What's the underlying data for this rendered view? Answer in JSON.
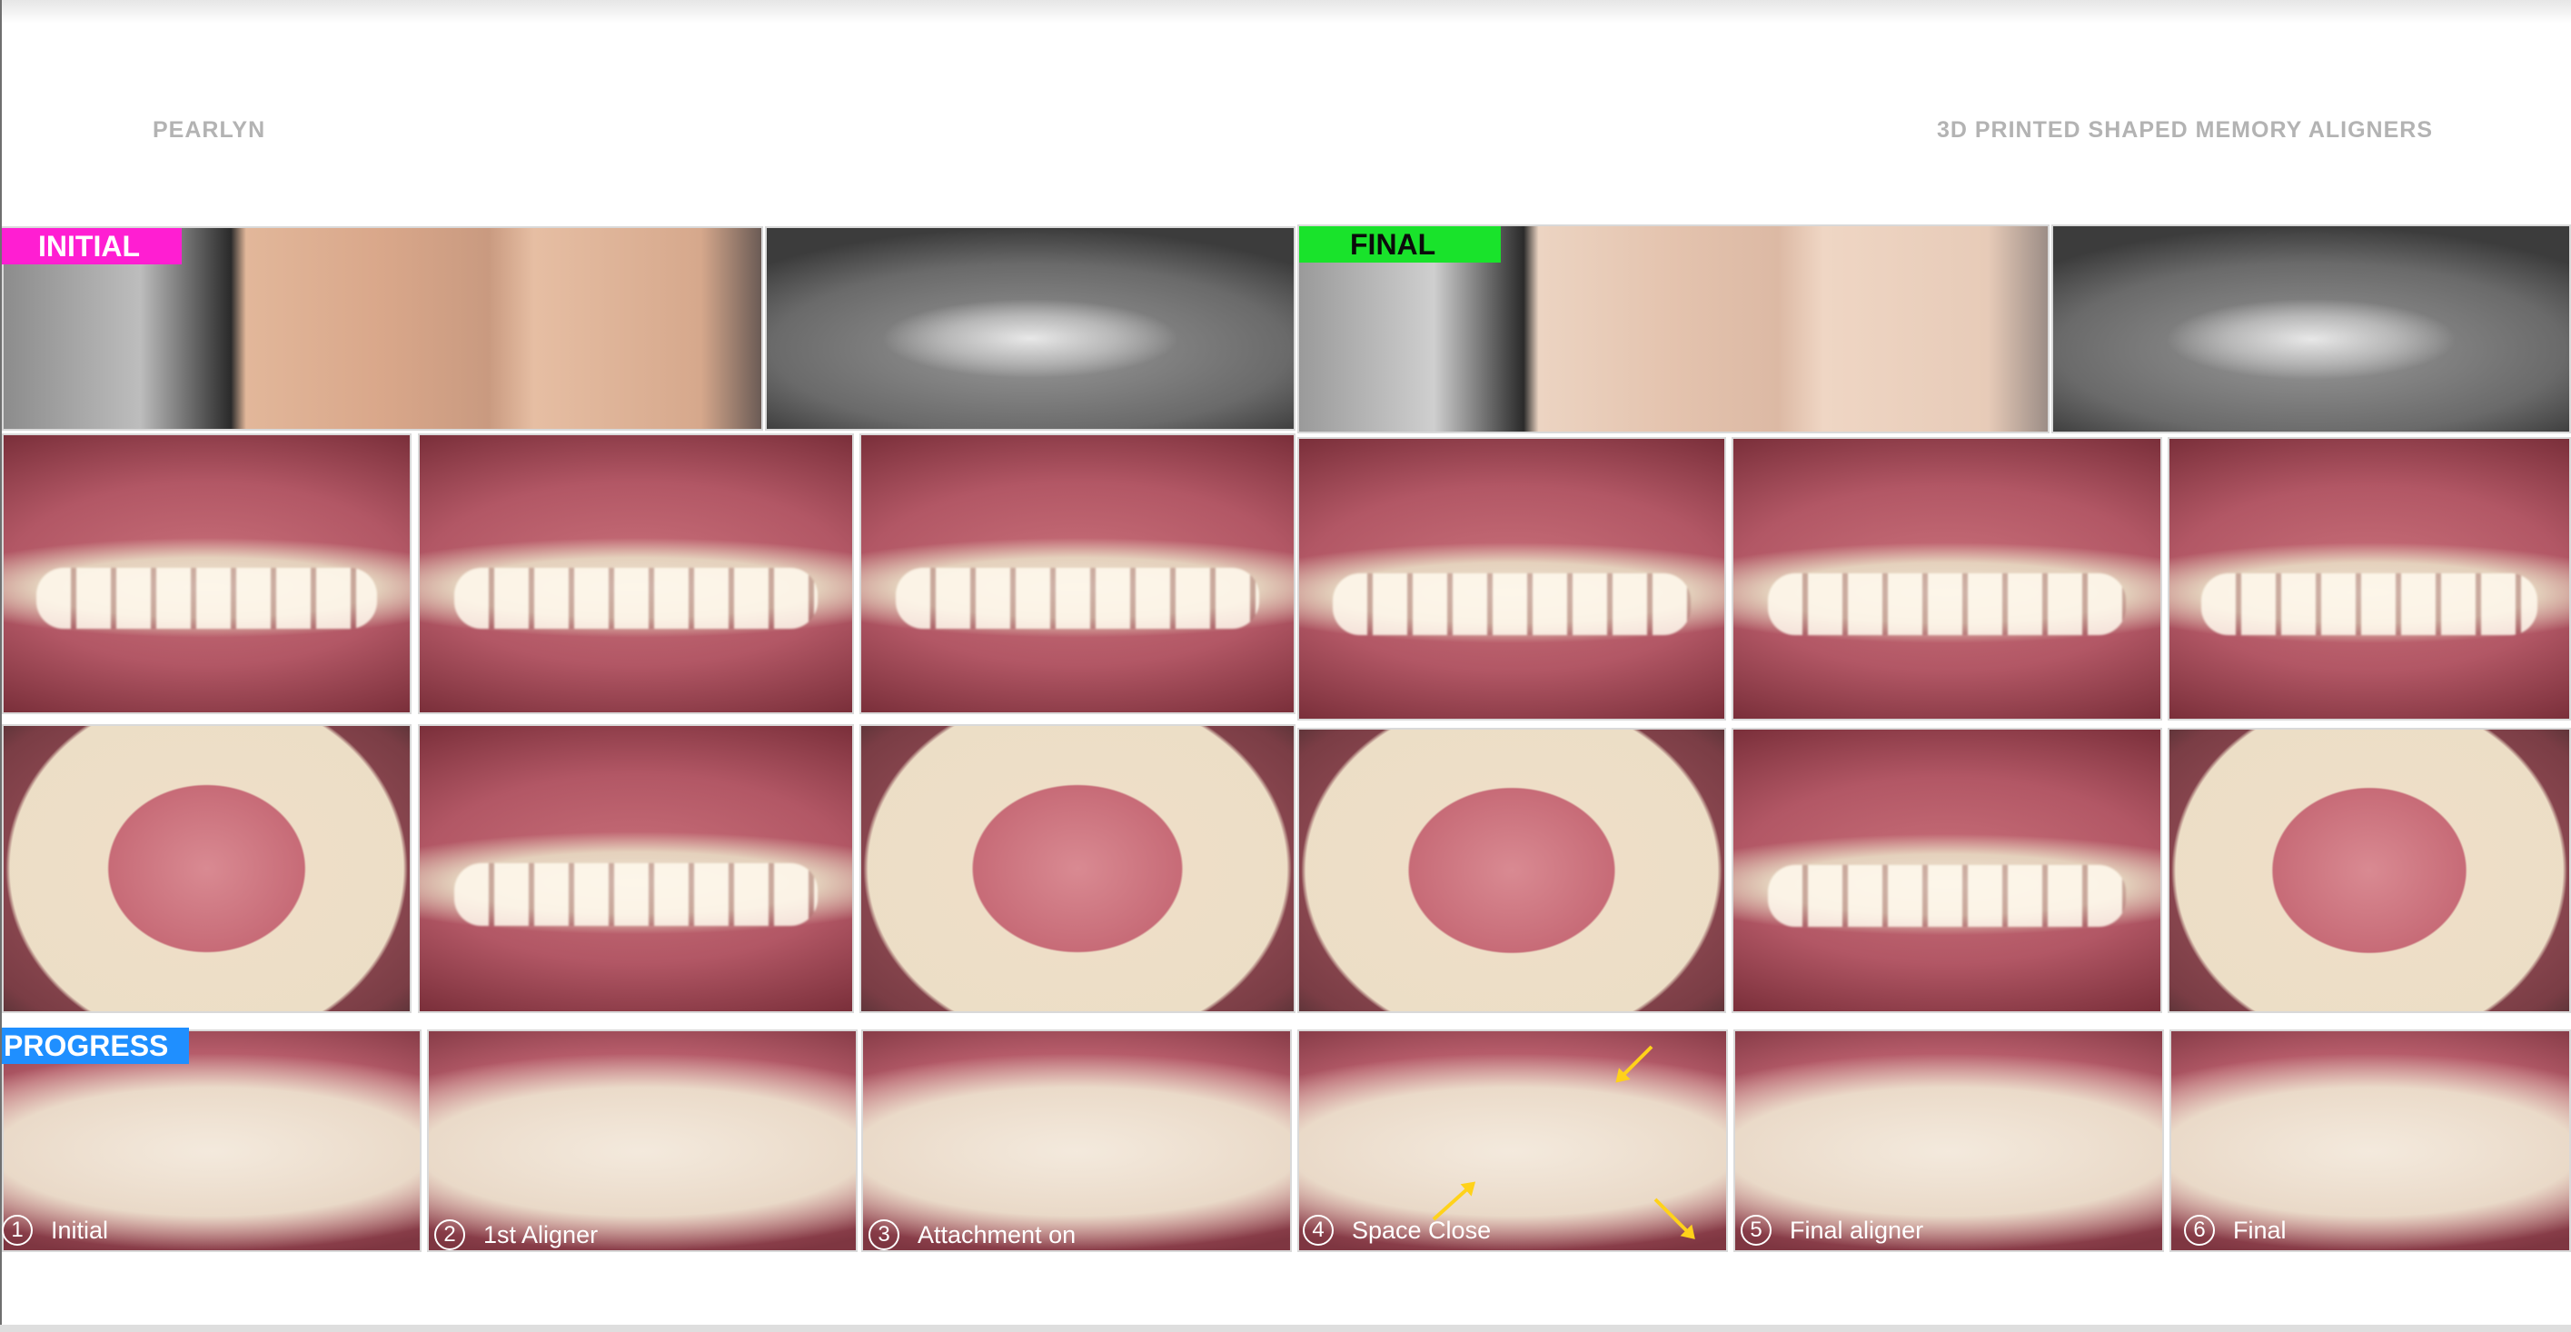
{
  "header": {
    "brand": "PEARLYN",
    "subtitle": "3D PRINTED SHAPED MEMORY ALIGNERS"
  },
  "sections": {
    "initial_label": "INITIAL",
    "final_label": "FINAL",
    "progress_label": "PROGRESS"
  },
  "progress_steps": [
    {
      "number": "1",
      "label": "Initial"
    },
    {
      "number": "2",
      "label": "1st Aligner"
    },
    {
      "number": "3",
      "label": "Attachment on"
    },
    {
      "number": "4",
      "label": "Space Close"
    },
    {
      "number": "5",
      "label": "Final aligner"
    },
    {
      "number": "6",
      "label": "Final"
    }
  ],
  "colors": {
    "initial_tag": "#ff1ed2",
    "final_tag": "#19e32b",
    "progress_tag": "#1f8fff",
    "arrow": "#ffd21a"
  }
}
